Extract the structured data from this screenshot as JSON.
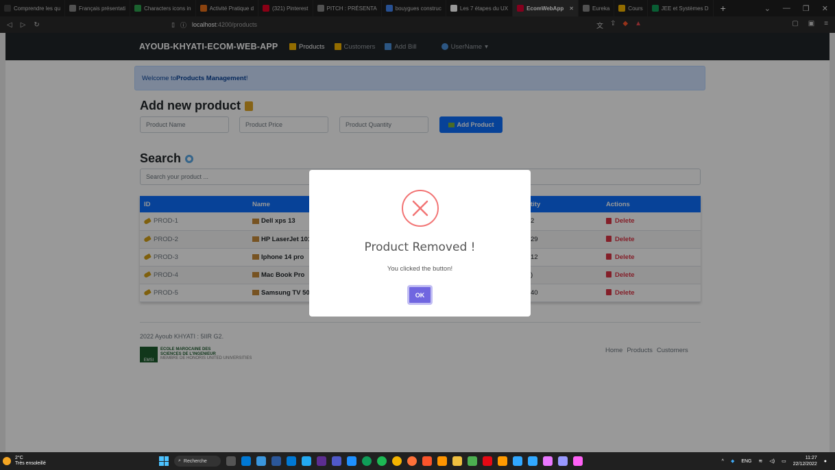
{
  "browser": {
    "tabs": [
      {
        "label": "Comprendre les qu",
        "color": "#444"
      },
      {
        "label": "Français présentati",
        "color": "#888"
      },
      {
        "label": "Characters icons in",
        "color": "#2ea44f"
      },
      {
        "label": "Activité Pratique d",
        "color": "#e8711a"
      },
      {
        "label": "(321) Pinterest",
        "color": "#e60023"
      },
      {
        "label": "PITCH : PRÉSENTA",
        "color": "#888"
      },
      {
        "label": "bouygues construc",
        "color": "#4285f4"
      },
      {
        "label": "Les 7 étapes du UX",
        "color": "#fff"
      },
      {
        "label": "EcomWebApp",
        "color": "#dd0031",
        "active": true
      },
      {
        "label": "Eureka",
        "color": "#888"
      },
      {
        "label": "Cours",
        "color": "#f4b400"
      },
      {
        "label": "JEE et Systèmes D",
        "color": "#0f9d58"
      }
    ],
    "url_host": "localhost",
    "url_path": ":4200/products"
  },
  "navbar": {
    "brand": "AYOUB-KHYATI-ECOM-WEB-APP",
    "links": [
      {
        "label": "Products",
        "active": true,
        "icon_color": "#f4b400"
      },
      {
        "label": "Customers",
        "active": false,
        "icon_color": "#f4b400"
      },
      {
        "label": "Add Bill",
        "active": false,
        "icon_color": "#4a90d9"
      }
    ],
    "user": "UserName"
  },
  "welcome": {
    "prefix": "Welcome to ",
    "strong": "Products Management",
    "suffix": "!"
  },
  "add_section": {
    "title": "Add new product",
    "name_placeholder": "Product Name",
    "price_placeholder": "Product Price",
    "quantity_placeholder": "Product Quantity",
    "button": "Add Product"
  },
  "search_section": {
    "title": "Search",
    "placeholder": "Search your product ..."
  },
  "table": {
    "headers": [
      "ID",
      "Name",
      "",
      "tity",
      "Actions"
    ],
    "rows": [
      {
        "id": "PROD-1",
        "name": "Dell xps 13",
        "qty": "2",
        "action": "Delete"
      },
      {
        "id": "PROD-2",
        "name": "HP LaserJet 101",
        "qty": "29",
        "action": "Delete"
      },
      {
        "id": "PROD-3",
        "name": "Iphone 14 pro",
        "qty": "12",
        "action": "Delete"
      },
      {
        "id": "PROD-4",
        "name": "Mac Book Pro",
        "qty": ")",
        "action": "Delete"
      },
      {
        "id": "PROD-5",
        "name": "Samsung TV 50",
        "qty": "40",
        "action": "Delete"
      }
    ]
  },
  "footer": {
    "copyright": "2022 Ayoub KHYATI : 5IIR G2.",
    "school_line1": "ECOLE MAROCAINE DES",
    "school_line2": "SCIENCES DE L'INGENIEUR",
    "school_sub": "MEMBRE DE HONORIS UNITED UNIVERSITIES",
    "links": [
      "Home",
      "Products",
      "Customers"
    ]
  },
  "modal": {
    "title": "Product Removed !",
    "text": "You clicked the button!",
    "button": "OK"
  },
  "taskbar": {
    "temp": "2°C",
    "weather": "Très ensoleillé",
    "search": "Recherche",
    "lang": "ENG",
    "time": "11:27",
    "date": "22/12/2022"
  }
}
